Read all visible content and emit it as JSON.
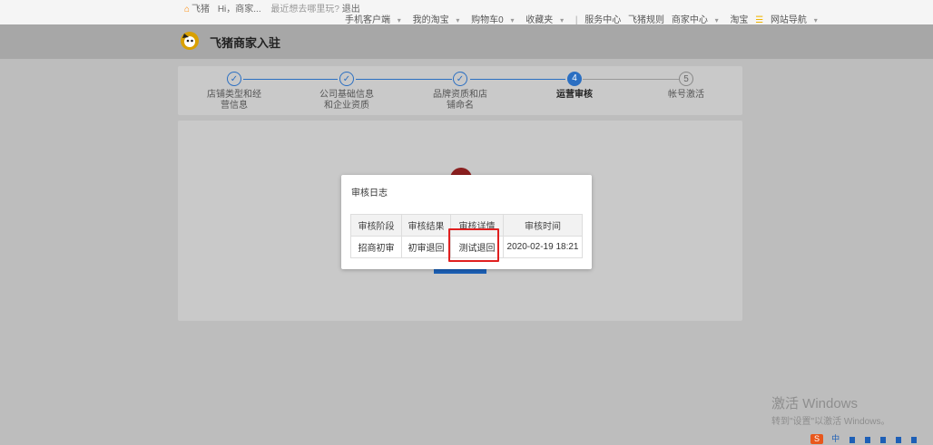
{
  "topbar": {
    "home": "飞猪",
    "greeting": "Hi，商家...",
    "ad": "最近想去哪里玩?",
    "logout": "退出",
    "links": [
      "手机客户端",
      "我的淘宝",
      "购物车0",
      "收藏夹",
      "服务中心",
      "飞猪规则",
      "商家中心",
      "淘宝",
      "网站导航"
    ]
  },
  "header": {
    "title": "飞猪商家入驻",
    "logo_icon": "fliggy-logo-icon"
  },
  "steps": [
    {
      "number": "✓",
      "label": "店铺类型和经营信息",
      "state": "done"
    },
    {
      "number": "✓",
      "label": "公司基础信息和企业资质",
      "state": "done"
    },
    {
      "number": "✓",
      "label": "品牌资质和店铺命名",
      "state": "done"
    },
    {
      "number": "4",
      "label": "运营审核",
      "state": "active"
    },
    {
      "number": "5",
      "label": "帐号激活",
      "state": "todo"
    }
  ],
  "modal": {
    "title": "审核日志",
    "columns": [
      "审核阶段",
      "审核结果",
      "审核详情",
      "审核时间"
    ],
    "rows": [
      [
        "招商初审",
        "初审退回",
        "测试退回",
        "2020-02-19 18:21"
      ]
    ]
  },
  "watermark": {
    "line1": "激活 Windows",
    "line2": "转到\"设置\"以激活 Windows。"
  },
  "ime": {
    "logo": "S",
    "lang": "中"
  },
  "colors": {
    "accent": "#2b6fc2",
    "highlight": "#e02020"
  }
}
